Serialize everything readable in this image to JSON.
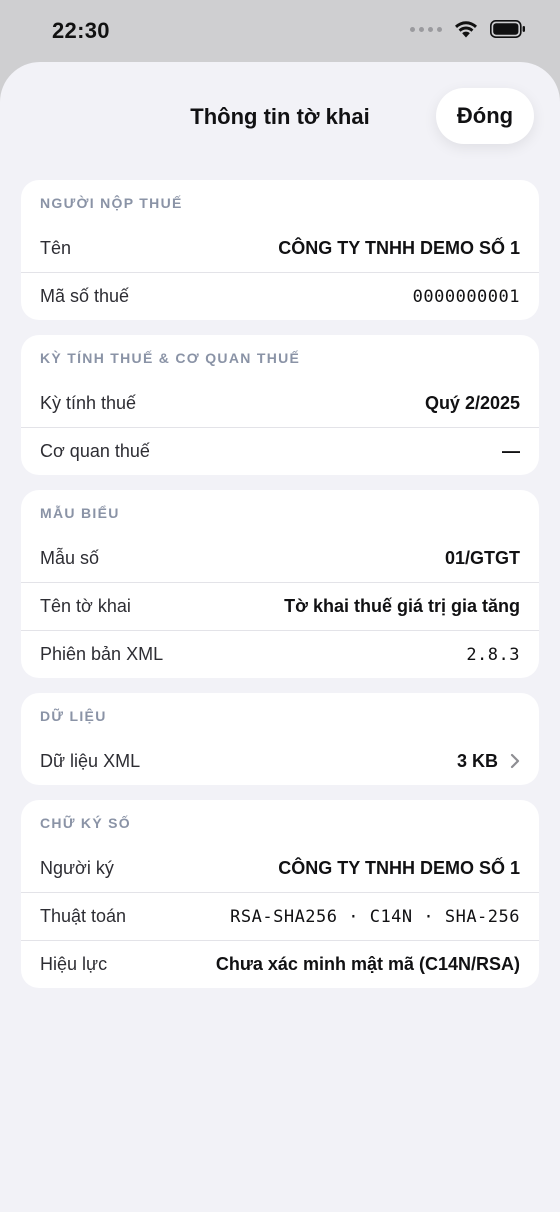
{
  "status": {
    "time": "22:30"
  },
  "sheet": {
    "title": "Thông tin tờ khai",
    "close_label": "Đóng"
  },
  "sections": {
    "taxpayer": {
      "header": "NGƯỜI NỘP THUẾ",
      "rows": [
        {
          "label": "Tên",
          "value": "CÔNG TY TNHH DEMO SỐ 1"
        },
        {
          "label": "Mã số thuế",
          "value": "0000000001"
        }
      ]
    },
    "period": {
      "header": "KỲ TÍNH THUẾ & CƠ QUAN THUẾ",
      "rows": [
        {
          "label": "Kỳ tính thuế",
          "value": "Quý 2/2025"
        },
        {
          "label": "Cơ quan thuế",
          "value": "—"
        }
      ]
    },
    "form": {
      "header": "MẪU BIỂU",
      "rows": [
        {
          "label": "Mẫu số",
          "value": "01/GTGT"
        },
        {
          "label": "Tên tờ khai",
          "value": "Tờ khai thuế giá trị gia tăng"
        },
        {
          "label": "Phiên bản XML",
          "value": "2.8.3"
        }
      ]
    },
    "data": {
      "header": "DỮ LIỆU",
      "rows": [
        {
          "label": "Dữ liệu XML",
          "value": "3 KB"
        }
      ]
    },
    "signature": {
      "header": "CHỮ KÝ SỐ",
      "rows": [
        {
          "label": "Người ký",
          "value": "CÔNG TY TNHH DEMO SỐ 1"
        },
        {
          "label": "Thuật toán",
          "value": "RSA-SHA256 · C14N · SHA-256"
        },
        {
          "label": "Hiệu lực",
          "value": "Chưa xác minh mật mã (C14N/RSA)"
        }
      ]
    }
  },
  "icons": {
    "wifi": "wifi-icon",
    "battery": "battery-icon",
    "chevron": "chevron-right-icon"
  },
  "colors": {
    "section_header": "#8a93a6",
    "background": "#f2f2f7",
    "card": "#ffffff"
  }
}
